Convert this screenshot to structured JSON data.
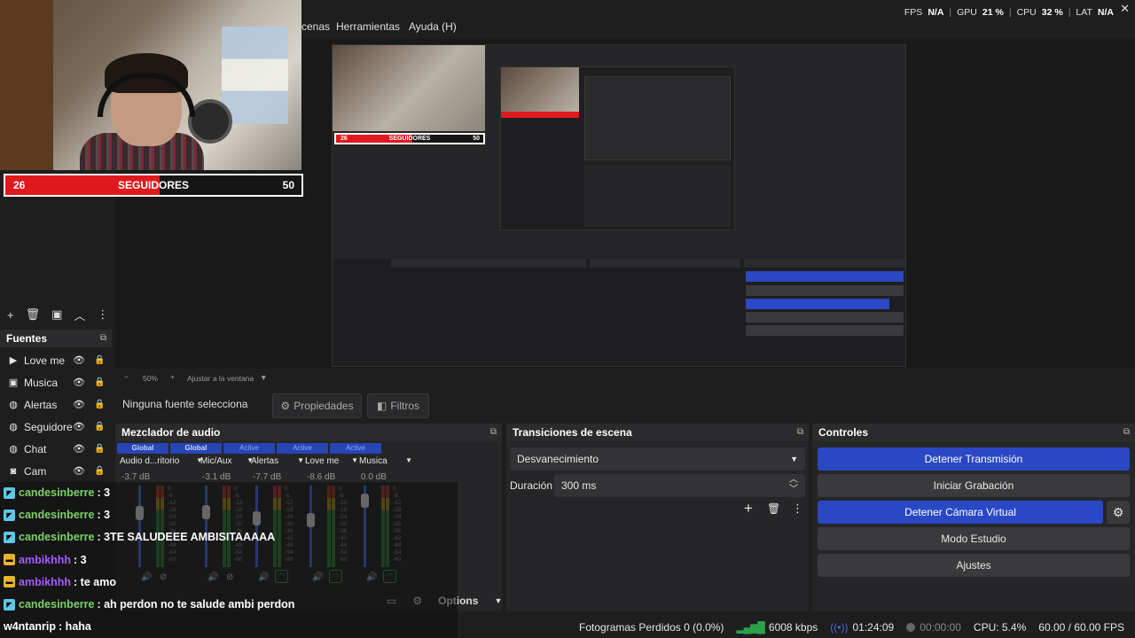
{
  "menubar": {
    "items": [
      "cenas",
      "Herramientas",
      "Ayuda (H)"
    ],
    "stats": {
      "fps_label": "FPS",
      "fps_value": "N/A",
      "gpu_label": "GPU",
      "gpu_value": "21 %",
      "cpu_label": "CPU",
      "cpu_value": "32 %",
      "lat_label": "LAT",
      "lat_value": "N/A"
    }
  },
  "overlay": {
    "followers_current": "26",
    "followers_title": "SEGUIDORES",
    "followers_goal": "50",
    "followers_progress": 0.52
  },
  "preview_toolbar": {
    "zoom": "50%",
    "fit_label": "Ajustar a la ventana"
  },
  "sources": {
    "header": "Fuentes",
    "items": [
      {
        "label": "Love me",
        "icon": "play-icon",
        "locked": false
      },
      {
        "label": "Musica",
        "icon": "image-icon",
        "locked": true
      },
      {
        "label": "Alertas",
        "icon": "globe-icon",
        "locked": true
      },
      {
        "label": "Seguidore",
        "icon": "globe-icon",
        "locked": true
      },
      {
        "label": "Chat",
        "icon": "globe-icon",
        "locked": true
      },
      {
        "label": "Cam",
        "icon": "camera-icon",
        "locked": true
      }
    ]
  },
  "properties_bar": {
    "no_source": "Ninguna fuente selecciona",
    "properties_label": "Propiedades",
    "filters_label": "Filtros"
  },
  "mixer": {
    "header": "Mezclador de audio",
    "channels": [
      {
        "tag": "Global",
        "name": "Audio d...ritorio",
        "db": "-3.7 dB",
        "level": 0.75
      },
      {
        "tag": "Global",
        "name": "Mic/Aux",
        "db": "-3.1 dB",
        "level": 0.76
      },
      {
        "tag": "Active",
        "name": "Alertas",
        "db": "-7.7 dB",
        "level": 0.68
      },
      {
        "tag": "Active",
        "name": "Love me",
        "db": "-8.6 dB",
        "level": 0.66
      },
      {
        "tag": "Active",
        "name": "Musica",
        "db": "0.0 dB",
        "level": 0.9
      }
    ],
    "scale": [
      "0",
      "-6",
      "-12",
      "-18",
      "-24",
      "-30",
      "-36",
      "-42",
      "-48",
      "-54",
      "-60"
    ],
    "options_label": "Options"
  },
  "transitions": {
    "header": "Transiciones de escena",
    "selected": "Desvanecimiento",
    "duration_label": "Duración",
    "duration_value": "300 ms"
  },
  "controls": {
    "header": "Controles",
    "buttons": [
      {
        "label": "Detener Transmisión",
        "active": true
      },
      {
        "label": "Iniciar Grabación",
        "active": false
      },
      {
        "label": "Detener Cámara Virtual",
        "active": true
      },
      {
        "label": "Modo Estudio",
        "active": false
      },
      {
        "label": "Ajustes",
        "active": false
      }
    ]
  },
  "chat": {
    "messages": [
      {
        "user": "candesinberre",
        "text": ": 3",
        "color": "#7bd36a",
        "badge": "#5ec8e6"
      },
      {
        "user": "candesinberre",
        "text": ": 3",
        "color": "#7bd36a",
        "badge": "#5ec8e6"
      },
      {
        "user": "candesinberre",
        "text": ": 3TE SALUDEEE AMBISITAAAAA",
        "color": "#7bd36a",
        "badge": "#5ec8e6"
      },
      {
        "user": "ambikhhh",
        "text": ": 3",
        "color": "#a35cff",
        "badge": "#e8b52a"
      },
      {
        "user": "ambikhhh",
        "text": ": te amo",
        "color": "#a35cff",
        "badge": "#e8b52a"
      },
      {
        "user": "candesinberre",
        "text": ": ah perdon no te salude ambi perdon",
        "color": "#7bd36a",
        "badge": "#5ec8e6"
      },
      {
        "user": "w4ntanrip",
        "text": ": haha",
        "color": "#ffffff",
        "badge": ""
      }
    ]
  },
  "statusbar": {
    "dropped_frames": "Fotogramas Perdidos 0 (0.0%)",
    "bitrate": "6008 kbps",
    "stream_time": "01:24:09",
    "rec_time": "00:00:00",
    "cpu": "CPU: 5.4%",
    "fps": "60.00 / 60.00 FPS"
  }
}
